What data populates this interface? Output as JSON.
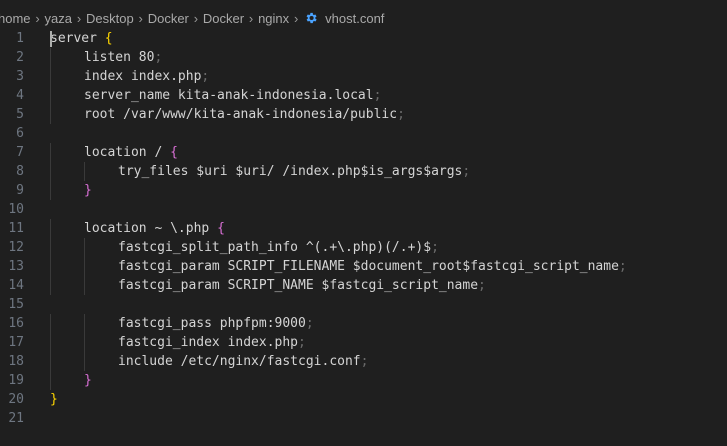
{
  "breadcrumbs": {
    "items": [
      "home",
      "yaza",
      "Desktop",
      "Docker",
      "Docker",
      "nginx"
    ],
    "file_name": "vhost.conf",
    "file_icon": "gear-icon"
  },
  "colors": {
    "background": "#1f1f1f",
    "line_number": "#6e7681",
    "default_text": "#d4d4d4",
    "punctuation": "#6b6b6b",
    "brace_outer": "#ffd700",
    "brace_inner": "#da70d6",
    "gear_icon": "#4aa3ff"
  },
  "editor": {
    "lines": [
      {
        "number": "1",
        "indent": 0,
        "tokens": [
          {
            "text": "server "
          },
          {
            "text": "{",
            "kind": "brace_outer"
          }
        ]
      },
      {
        "number": "2",
        "indent": 1,
        "tokens": [
          {
            "text": "listen 80"
          },
          {
            "text": ";",
            "kind": "punctuation"
          }
        ]
      },
      {
        "number": "3",
        "indent": 1,
        "tokens": [
          {
            "text": "index index.php"
          },
          {
            "text": ";",
            "kind": "punctuation"
          }
        ]
      },
      {
        "number": "4",
        "indent": 1,
        "tokens": [
          {
            "text": "server_name kita-anak-indonesia.local"
          },
          {
            "text": ";",
            "kind": "punctuation"
          }
        ]
      },
      {
        "number": "5",
        "indent": 1,
        "tokens": [
          {
            "text": "root /var/www/kita-anak-indonesia/public"
          },
          {
            "text": ";",
            "kind": "punctuation"
          }
        ]
      },
      {
        "number": "6",
        "indent": 0,
        "tokens": []
      },
      {
        "number": "7",
        "indent": 1,
        "tokens": [
          {
            "text": "location / "
          },
          {
            "text": "{",
            "kind": "brace_inner"
          }
        ]
      },
      {
        "number": "8",
        "indent": 2,
        "tokens": [
          {
            "text": "try_files $uri $uri/ /index.php$is_args$args"
          },
          {
            "text": ";",
            "kind": "punctuation"
          }
        ]
      },
      {
        "number": "9",
        "indent": 1,
        "tokens": [
          {
            "text": "}",
            "kind": "brace_inner"
          }
        ]
      },
      {
        "number": "10",
        "indent": 0,
        "tokens": []
      },
      {
        "number": "11",
        "indent": 1,
        "tokens": [
          {
            "text": "location ~ \\.php "
          },
          {
            "text": "{",
            "kind": "brace_inner"
          }
        ]
      },
      {
        "number": "12",
        "indent": 2,
        "tokens": [
          {
            "text": "fastcgi_split_path_info ^(.+\\.php)(/.+)$"
          },
          {
            "text": ";",
            "kind": "punctuation"
          }
        ]
      },
      {
        "number": "13",
        "indent": 2,
        "tokens": [
          {
            "text": "fastcgi_param SCRIPT_FILENAME $document_root$fastcgi_script_name"
          },
          {
            "text": ";",
            "kind": "punctuation"
          }
        ]
      },
      {
        "number": "14",
        "indent": 2,
        "tokens": [
          {
            "text": "fastcgi_param SCRIPT_NAME $fastcgi_script_name"
          },
          {
            "text": ";",
            "kind": "punctuation"
          }
        ]
      },
      {
        "number": "15",
        "indent": 0,
        "tokens": []
      },
      {
        "number": "16",
        "indent": 2,
        "tokens": [
          {
            "text": "fastcgi_pass phpfpm:9000"
          },
          {
            "text": ";",
            "kind": "punctuation"
          }
        ]
      },
      {
        "number": "17",
        "indent": 2,
        "tokens": [
          {
            "text": "fastcgi_index index.php"
          },
          {
            "text": ";",
            "kind": "punctuation"
          }
        ]
      },
      {
        "number": "18",
        "indent": 2,
        "tokens": [
          {
            "text": "include /etc/nginx/fastcgi.conf"
          },
          {
            "text": ";",
            "kind": "punctuation"
          }
        ]
      },
      {
        "number": "19",
        "indent": 1,
        "tokens": [
          {
            "text": "}",
            "kind": "brace_inner"
          }
        ]
      },
      {
        "number": "20",
        "indent": 0,
        "tokens": [
          {
            "text": "}",
            "kind": "brace_outer"
          }
        ]
      },
      {
        "number": "21",
        "indent": 0,
        "tokens": []
      }
    ]
  }
}
